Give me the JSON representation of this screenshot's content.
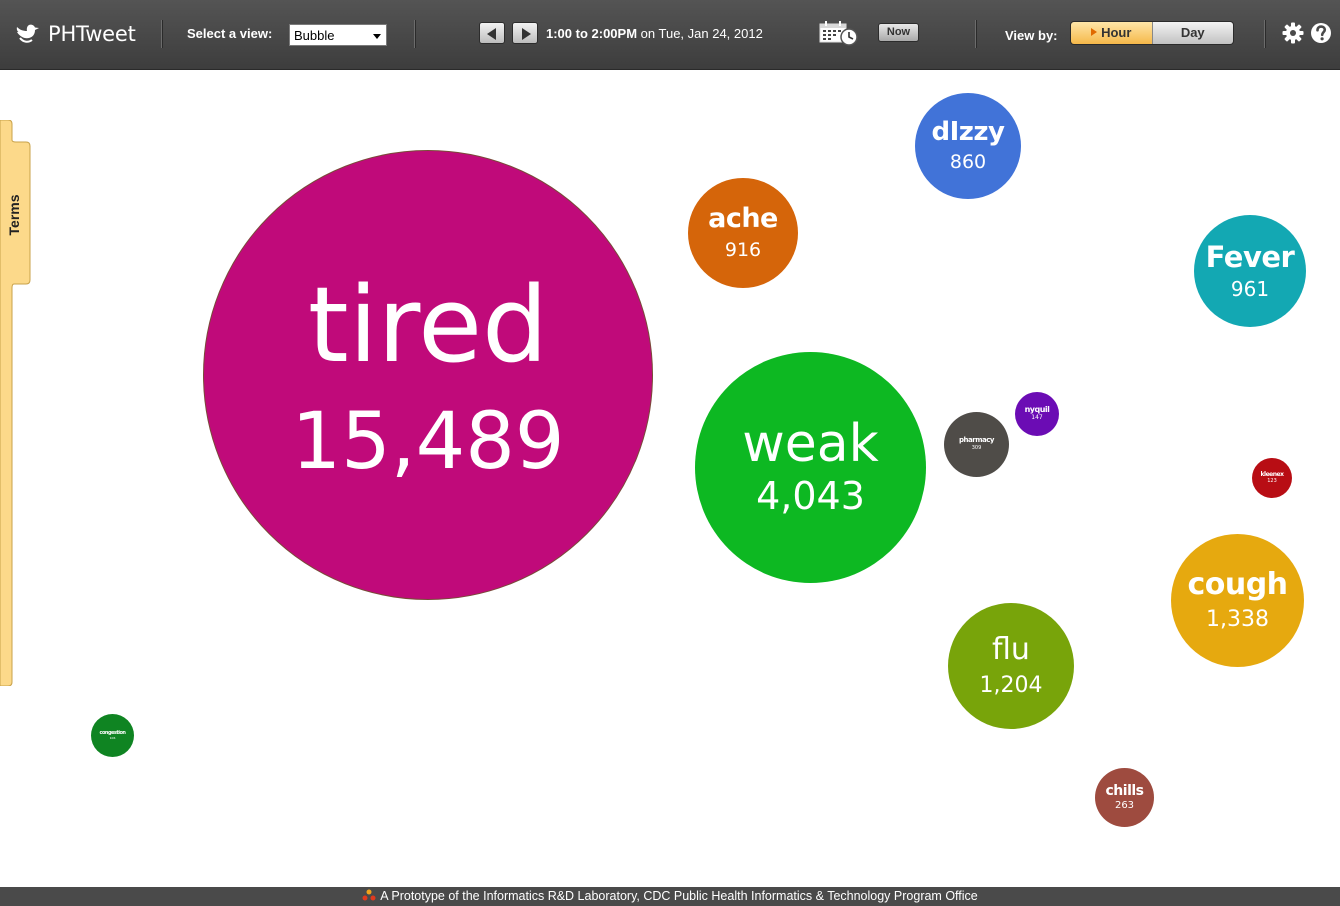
{
  "app": {
    "name": "PHTweet"
  },
  "toolbar": {
    "view_label": "Select a view:",
    "view_value": "Bubble",
    "time_range": "1:00 to 2:00PM",
    "time_on": "on Tue, Jan 24, 2012",
    "now_label": "Now",
    "view_by_label": "View by:",
    "view_by_options": [
      "Hour",
      "Day"
    ],
    "view_by_selected": "Hour"
  },
  "sidebar": {
    "tab_label": "Terms"
  },
  "bubbles": {
    "tired": {
      "term": "tired",
      "count": "15,489",
      "color": "#c00a7a"
    },
    "weak": {
      "term": "weak",
      "count": "4,043",
      "color": "#0db822"
    },
    "ache": {
      "term": "ache",
      "count": "916",
      "color": "#d5650a"
    },
    "dizzy": {
      "term": "dIzzy",
      "count": "860",
      "color": "#4173d8"
    },
    "fever": {
      "term": "Fever",
      "count": "961",
      "color": "#13a8b3"
    },
    "cough": {
      "term": "cough",
      "count": "1,338",
      "color": "#e6a90f"
    },
    "flu": {
      "term": "flu",
      "count": "1,204",
      "color": "#78a40a"
    },
    "chills": {
      "term": "chills",
      "count": "263",
      "color": "#9e4b3f"
    },
    "pharmacy": {
      "term": "pharmacy",
      "count": "309",
      "color": "#4f4c48"
    },
    "nyquil": {
      "term": "nyquil",
      "count": "147",
      "color": "#6b0cb4"
    },
    "kleenex": {
      "term": "kleenex",
      "count": "123",
      "color": "#b80d14"
    },
    "congestion": {
      "term": "congestion",
      "count": "106",
      "color": "#0f8422"
    }
  },
  "footer": {
    "text": "A Prototype of the Informatics R&D Laboratory, CDC Public Health Informatics & Technology Program Office"
  }
}
